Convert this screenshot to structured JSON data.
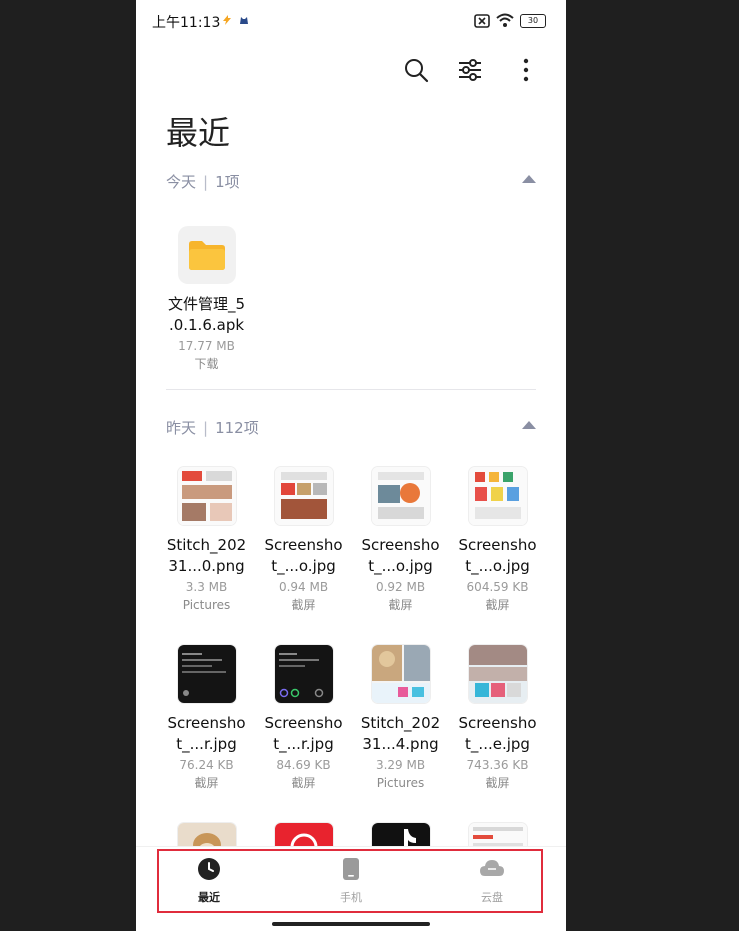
{
  "status_bar": {
    "time": "上午11:13",
    "battery": "30"
  },
  "toolbar": {
    "search_icon": "search-icon",
    "filter_icon": "sliders-icon",
    "more_icon": "more-vertical-icon"
  },
  "page": {
    "title": "最近"
  },
  "sections": [
    {
      "day": "今天",
      "count": "1项",
      "files": [
        {
          "name": "文件管理_5\n.0.1.6.apk",
          "size": "17.77 MB",
          "source": "下载",
          "thumb": "folder"
        }
      ]
    },
    {
      "day": "昨天",
      "count": "112项",
      "files": [
        {
          "name": "Stitch_202\n31...0.png",
          "size": "3.3 MB",
          "source": "Pictures",
          "thumb": "light"
        },
        {
          "name": "Screensho\nt_...o.jpg",
          "size": "0.94 MB",
          "source": "截屏",
          "thumb": "light"
        },
        {
          "name": "Screensho\nt_...o.jpg",
          "size": "0.92 MB",
          "source": "截屏",
          "thumb": "light"
        },
        {
          "name": "Screensho\nt_...o.jpg",
          "size": "604.59 KB",
          "source": "截屏",
          "thumb": "light"
        },
        {
          "name": "Screensho\nt_...r.jpg",
          "size": "76.24 KB",
          "source": "截屏",
          "thumb": "dark"
        },
        {
          "name": "Screensho\nt_...r.jpg",
          "size": "84.69 KB",
          "source": "截屏",
          "thumb": "dark"
        },
        {
          "name": "Stitch_202\n31...4.png",
          "size": "3.29 MB",
          "source": "Pictures",
          "thumb": "dog"
        },
        {
          "name": "Screensho\nt_...e.jpg",
          "size": "743.36 KB",
          "source": "截屏",
          "thumb": "photo"
        }
      ]
    }
  ],
  "bottom_nav": [
    {
      "label": "最近",
      "icon": "clock-icon",
      "active": true
    },
    {
      "label": "手机",
      "icon": "phone-icon",
      "active": false
    },
    {
      "label": "云盘",
      "icon": "cloud-icon",
      "active": false
    }
  ],
  "colors": {
    "accent_folder": "#f7b52c",
    "section_text": "#8a8fa3",
    "highlight": "#e02c3c"
  }
}
